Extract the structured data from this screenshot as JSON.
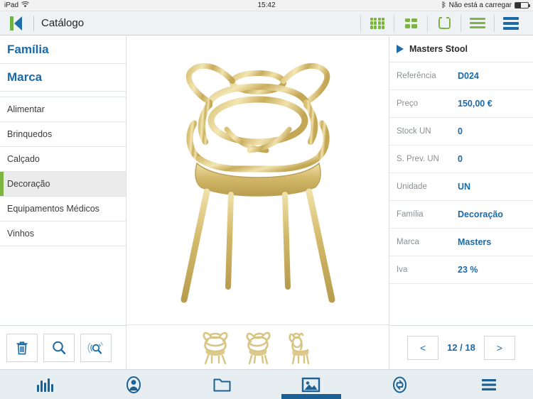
{
  "statusbar": {
    "device": "iPad",
    "wifi_icon": "wifi-icon",
    "time": "15:42",
    "bluetooth_icon": "bluetooth-icon",
    "battery_text": "Não está a carregar",
    "battery_icon": "battery-icon",
    "battery_level_pct": 42
  },
  "navbar": {
    "back_icon": "back-to-start-icon",
    "title": "Catálogo",
    "icons": [
      {
        "name": "grid-dense-icon",
        "color": "#7cb342"
      },
      {
        "name": "grid-four-icon",
        "color": "#7cb342"
      },
      {
        "name": "rounded-square-icon",
        "color": "#7cb342"
      },
      {
        "name": "menu-lines-green-icon",
        "color": "#7cb342"
      },
      {
        "name": "menu-lines-blue-icon",
        "color": "#1c6aa5"
      }
    ]
  },
  "sidebar": {
    "headers": [
      {
        "label": "Família"
      },
      {
        "label": "Marca"
      }
    ],
    "items": [
      {
        "label": "Alimentar",
        "selected": false
      },
      {
        "label": "Brinquedos",
        "selected": false
      },
      {
        "label": "Calçado",
        "selected": false
      },
      {
        "label": "Decoração",
        "selected": true
      },
      {
        "label": "Equipamentos Médicos",
        "selected": false
      },
      {
        "label": "Vinhos",
        "selected": false
      }
    ],
    "actions": [
      {
        "name": "delete-button",
        "icon": "trash-icon"
      },
      {
        "name": "search-button",
        "icon": "magnifier-icon"
      },
      {
        "name": "advanced-search-button",
        "icon": "magnifier-signal-icon"
      }
    ]
  },
  "product": {
    "image_alt": "Masters Stool chair in gold",
    "thumbnails": [
      {
        "name": "thumbnail-front",
        "alt": "chair front view"
      },
      {
        "name": "thumbnail-angle",
        "alt": "chair three-quarter view"
      },
      {
        "name": "thumbnail-side",
        "alt": "chair side view"
      }
    ]
  },
  "detail": {
    "title": "Masters Stool",
    "expand_icon": "triangle-right-icon",
    "rows": [
      {
        "label": "Referência",
        "value": "D024"
      },
      {
        "label": "Preço",
        "value": "150,00 €"
      },
      {
        "label": "Stock UN",
        "value": "0"
      },
      {
        "label": "S. Prev. UN",
        "value": "0"
      },
      {
        "label": "Unidade",
        "value": "UN"
      },
      {
        "label": "Família",
        "value": "Decoração"
      },
      {
        "label": "Marca",
        "value": "Masters"
      },
      {
        "label": "Iva",
        "value": "23 %"
      }
    ],
    "pagination": {
      "prev_label": "<",
      "counter": "12 / 18",
      "next_label": ">"
    }
  },
  "tabbar": {
    "tabs": [
      {
        "name": "tab-statistics",
        "icon": "bar-chart-icon",
        "selected": false
      },
      {
        "name": "tab-contacts",
        "icon": "person-icon",
        "selected": false
      },
      {
        "name": "tab-documents",
        "icon": "folder-icon",
        "selected": false
      },
      {
        "name": "tab-catalog",
        "icon": "image-icon",
        "selected": true
      },
      {
        "name": "tab-sync",
        "icon": "sync-icon",
        "selected": false
      },
      {
        "name": "tab-menu",
        "icon": "hamburger-icon",
        "selected": false
      }
    ]
  },
  "colors": {
    "accent_green": "#7cb342",
    "accent_blue": "#1a6aa8",
    "tab_selected": "#1c5f94"
  }
}
